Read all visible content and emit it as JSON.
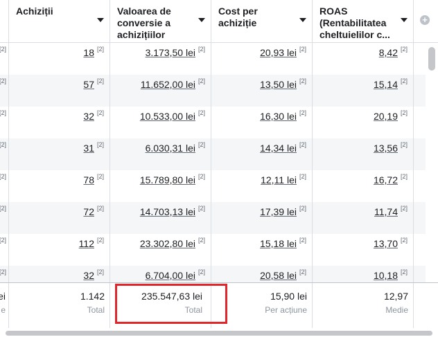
{
  "columns": [
    {
      "label": "Achiziții"
    },
    {
      "label": "Valoarea de conversie a achizițiilor"
    },
    {
      "label": "Cost per achiziție"
    },
    {
      "label": "ROAS (Rentabilitatea cheltuielilor c..."
    }
  ],
  "superscript": "[2]",
  "rows": [
    {
      "achizitii": "18",
      "valoare": "3.173,50 lei",
      "cost": "20,93 lei",
      "roas": "8,42"
    },
    {
      "achizitii": "57",
      "valoare": "11.652,00 lei",
      "cost": "13,50 lei",
      "roas": "15,14"
    },
    {
      "achizitii": "32",
      "valoare": "10.533,00 lei",
      "cost": "16,30 lei",
      "roas": "20,19"
    },
    {
      "achizitii": "31",
      "valoare": "6.030,31 lei",
      "cost": "14,34 lei",
      "roas": "13,56"
    },
    {
      "achizitii": "78",
      "valoare": "15.789,80 lei",
      "cost": "12,11 lei",
      "roas": "16,72"
    },
    {
      "achizitii": "72",
      "valoare": "14.703,13 lei",
      "cost": "17,39 lei",
      "roas": "11,74"
    },
    {
      "achizitii": "112",
      "valoare": "23.302,80 lei",
      "cost": "15,18 lei",
      "roas": "13,70"
    },
    {
      "achizitii": "32",
      "valoare": "6.704,00 lei",
      "cost": "20,58 lei",
      "roas": "10,18"
    }
  ],
  "footer": {
    "stub_value": "ei",
    "stub_sub": "e",
    "achizitii": {
      "value": "1.142",
      "sub": "Total"
    },
    "valoare": {
      "value": "235.547,63 lei",
      "sub": "Total"
    },
    "cost": {
      "value": "15,90 lei",
      "sub": "Per acțiune"
    },
    "roas": {
      "value": "12,97",
      "sub": "Medie"
    }
  },
  "colors": {
    "highlight": "#e0262b",
    "border": "#dadde1",
    "alt_row": "#f5f6f7"
  }
}
